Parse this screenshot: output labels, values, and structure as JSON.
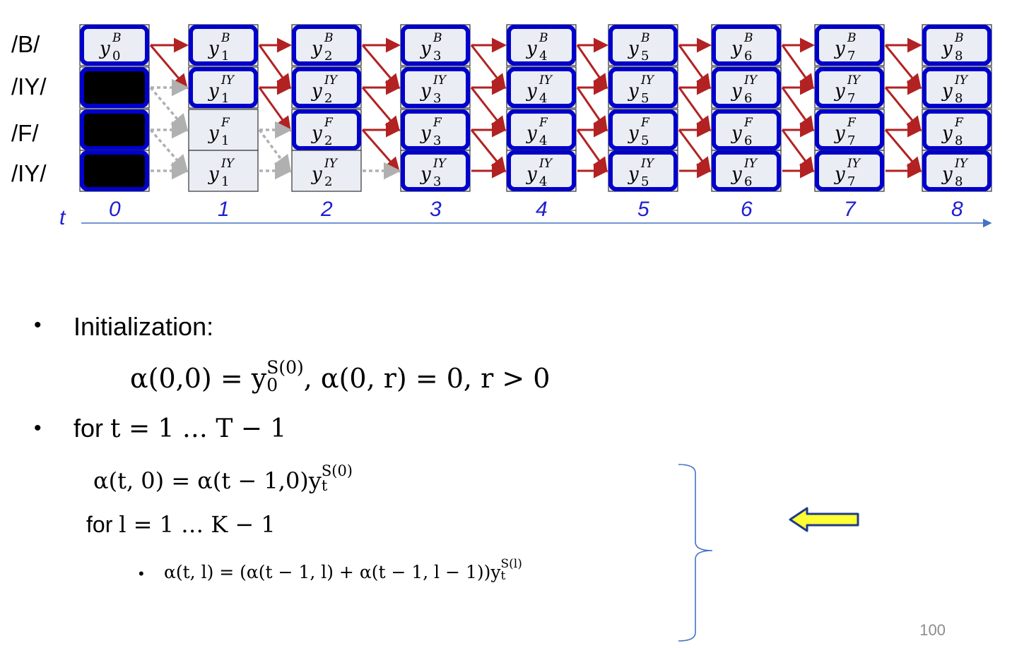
{
  "row_labels": [
    "/B/",
    "/IY/",
    "/F/",
    "/IY/"
  ],
  "row_symbols": [
    "B",
    "IY",
    "F",
    "IY"
  ],
  "cell_base": "y",
  "time_axis": {
    "label": "t",
    "ticks": [
      "0",
      "1",
      "2",
      "3",
      "4",
      "5",
      "6",
      "7",
      "8"
    ]
  },
  "colors": {
    "highlight": "#0000cc",
    "arrow": "#b22222",
    "dotted": "#b0b0b0",
    "cell": "#eaedf3",
    "axis": "#4472c4",
    "tick": "#1f1fd0",
    "yellow": "#ffff33"
  },
  "bullets": {
    "init_label": "Initialization:",
    "init_eq": {
      "a": "α(0,0) = y",
      "sub": "0",
      "sup": "S(0)",
      "b": ",    α(0, r) = 0,  r > 0"
    },
    "for_t_prefix": "for",
    "for_t_eq": "t  =  1 … T − 1",
    "alpha_t0": {
      "a": "α(t, 0)  = α(t − 1,0)y",
      "sub": "t",
      "sup": "S(0)"
    },
    "for_l_prefix": "for",
    "for_l_eq": "l  = 1 … K − 1",
    "alpha_tl": {
      "a": "α(t, l)  = (α(t − 1, l) + α(t − 1, l − 1))y",
      "sub": "t",
      "sup": "S(l)"
    }
  },
  "page_number": "100"
}
